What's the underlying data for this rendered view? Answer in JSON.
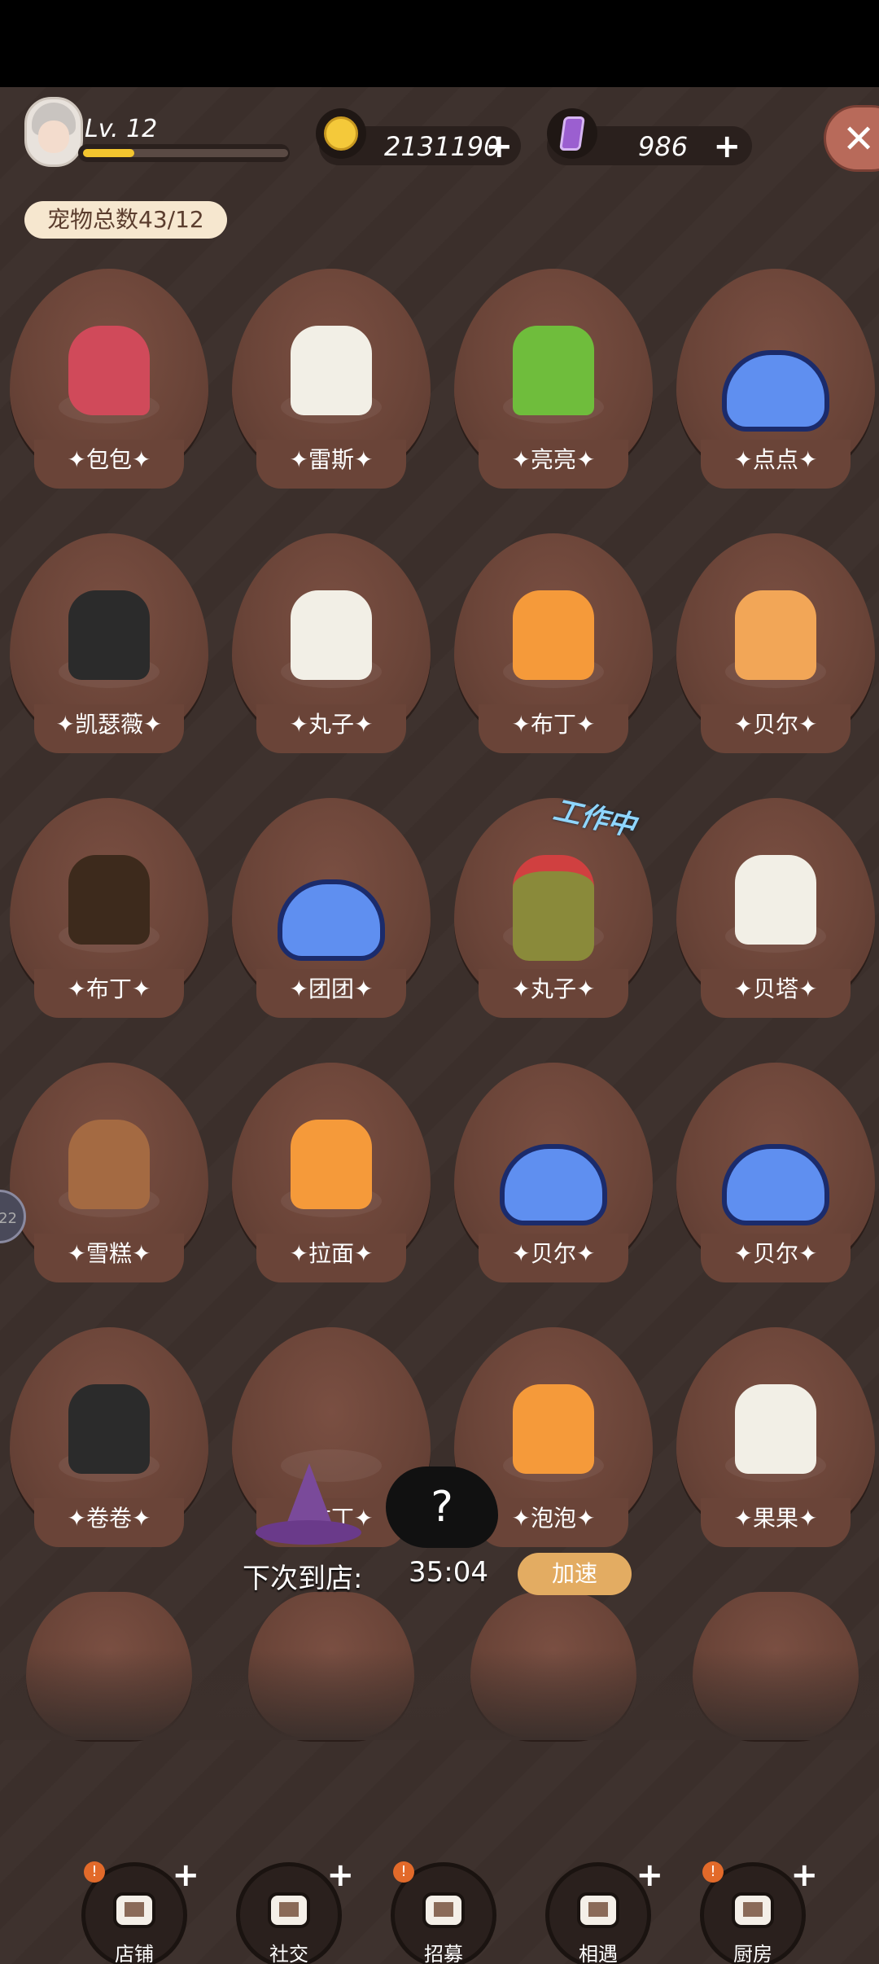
{
  "header": {
    "level": "Lv. 12",
    "xp_fraction": 0.25,
    "coins": "2131190",
    "gems": "986",
    "add_symbol": "+",
    "close_symbol": "✕"
  },
  "pet_count_label": "宠物总数43/12",
  "pets": [
    {
      "name": "包包",
      "icon": "parrot"
    },
    {
      "name": "雷斯",
      "icon": "calico-cat"
    },
    {
      "name": "亮亮",
      "icon": "goblin"
    },
    {
      "name": "点点",
      "icon": "blue-slime"
    },
    {
      "name": "凯瑟薇",
      "icon": "husky"
    },
    {
      "name": "丸子",
      "icon": "grey-cat"
    },
    {
      "name": "布丁",
      "icon": "orange-cat"
    },
    {
      "name": "贝尔",
      "icon": "shiba"
    },
    {
      "name": "布丁",
      "icon": "shepherd"
    },
    {
      "name": "团团",
      "icon": "blue-slime"
    },
    {
      "name": "丸子",
      "icon": "knight-helmet"
    },
    {
      "name": "贝塔",
      "icon": "calico-cat"
    },
    {
      "name": "雪糕",
      "icon": "monkey"
    },
    {
      "name": "拉面",
      "icon": "orange-cat"
    },
    {
      "name": "贝尔",
      "icon": "blue-slime"
    },
    {
      "name": "贝尔",
      "icon": "blue-slime"
    },
    {
      "name": "卷卷",
      "icon": "husky"
    },
    {
      "name": "布丁",
      "icon": "wizard-hat"
    },
    {
      "name": "泡泡",
      "icon": "orange-cat"
    },
    {
      "name": "果果",
      "icon": "grey-cat"
    }
  ],
  "working_label": "工作中",
  "mystery_symbol": "?",
  "next_visit": {
    "label": "下次到店:",
    "time": "35:04",
    "speed_up": "加速"
  },
  "side_handle_text": "22",
  "nav": [
    {
      "label": "店铺",
      "alert": true,
      "plus": true,
      "icon": "shop-icon"
    },
    {
      "label": "社交",
      "alert": false,
      "plus": true,
      "icon": "coffee-icon"
    },
    {
      "label": "招募",
      "alert": true,
      "plus": false,
      "icon": "door-icon"
    },
    {
      "label": "相遇",
      "alert": false,
      "plus": true,
      "icon": "handshake-icon"
    },
    {
      "label": "厨房",
      "alert": true,
      "plus": true,
      "icon": "pan-icon"
    }
  ],
  "alert_symbol": "!"
}
